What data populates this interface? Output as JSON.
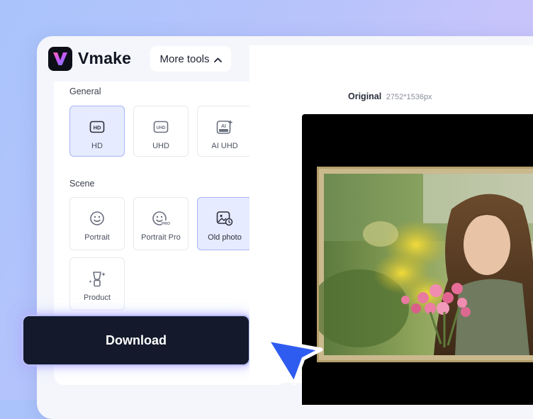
{
  "app": {
    "name": "Vmake"
  },
  "header": {
    "more_tools_label": "More tools"
  },
  "general": {
    "title": "General",
    "options": [
      {
        "label": "HD",
        "icon": "hd-icon",
        "selected": true
      },
      {
        "label": "UHD",
        "icon": "uhd-icon",
        "selected": false
      },
      {
        "label": "AI UHD",
        "icon": "ai-ultra-icon",
        "selected": false
      }
    ]
  },
  "scene": {
    "title": "Scene",
    "options": [
      {
        "label": "Portrait",
        "icon": "smile-icon",
        "selected": false
      },
      {
        "label": "Portrait Pro",
        "icon": "smile-pro-icon",
        "selected": false
      },
      {
        "label": "Old photo",
        "icon": "old-photo-icon",
        "selected": true
      },
      {
        "label": "Product",
        "icon": "product-icon",
        "selected": false
      }
    ]
  },
  "download_label": "Download",
  "preview": {
    "label": "Original",
    "dimensions": "2752*1536px"
  },
  "colors": {
    "accent": "#2f5cf0",
    "selected_bg": "#e6ebff",
    "button_bg": "#141a2b"
  }
}
